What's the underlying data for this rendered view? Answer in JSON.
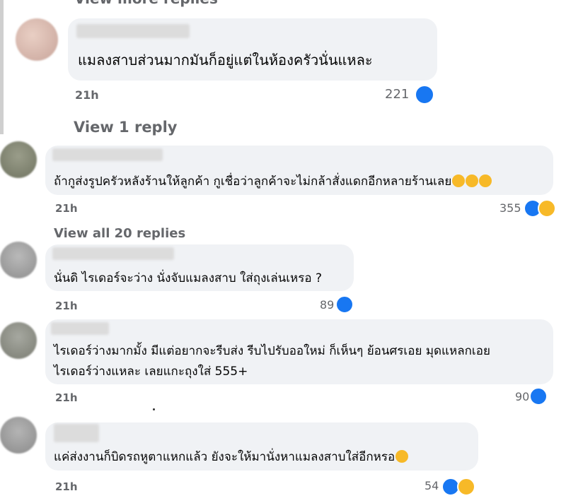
{
  "top": {
    "more_replies": "View more replies",
    "view_reply": "View 1 reply"
  },
  "comments": [
    {
      "text": "แมลงสาบส่วนมากมันก็อยู่แต่ในห้องครัวนั่นแหละ",
      "time": "21h",
      "count": "221",
      "reactions": [
        "like"
      ]
    },
    {
      "text": "ถ้ากูส่งรูปครัวหลังร้านให้ลูกค้า กูเชื่อว่าลูกค้าจะไม่กล้าสั่งแดกอีกหลายร้านเลย",
      "emojis": [
        "rofl",
        "rofl",
        "rofl"
      ],
      "time": "21h",
      "count": "355",
      "reactions": [
        "like",
        "haha"
      ],
      "view_replies": "View all 20 replies"
    },
    {
      "text": "นั่นดิ ไรเดอร์จะว่าง นั่งจับแมลงสาบ ใส่ถุงเล่นเหรอ ?",
      "time": "21h",
      "count": "89",
      "reactions": [
        "like"
      ]
    },
    {
      "text_line1": "ไรเดอร์ว่างมากมั้ง มีแต่อยากจะรีบส่ง รีบไปรับออใหม่ ก็เห็นๆ ย้อนศรเอย มุดแหลกเอย",
      "text_line2": "ไรเดอร์ว่างแหละ เลยแกะถุงใส่ 555+",
      "time": "21h",
      "count": "90",
      "reactions": [
        "like"
      ]
    },
    {
      "text": "แค่ส่งงานก็บิดรถหูตาแหกแล้ว ยังจะให้มานั่งหาแมลงสาบใส่อีกหรอ",
      "emojis": [
        "rofl"
      ],
      "time": "21h",
      "count": "54",
      "reactions": [
        "like",
        "haha"
      ]
    }
  ],
  "colors": {
    "bubble": "#f0f2f5",
    "like": "#1877f2",
    "haha": "#f7b928",
    "meta_text": "#65676b"
  }
}
